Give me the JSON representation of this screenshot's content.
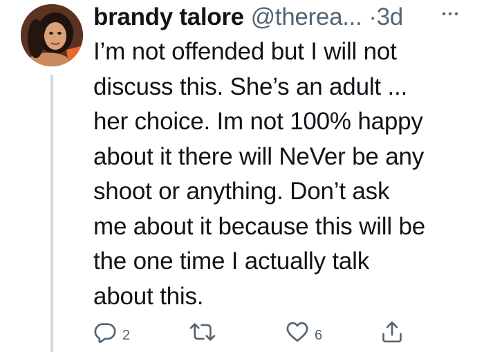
{
  "tweet": {
    "author": {
      "name": "brandy talore",
      "handle": "@therea...",
      "separator": "·",
      "time": "3d",
      "avatar_icon": "avatar-photo"
    },
    "text": "I’m not offended but I will not discuss this. She’s an adult ... her choice. Im not 100% happy about it there will NeVer be any shoot or anything. Don’t ask me about it because this will be the one time I actually talk about this.",
    "lines": [
      "I’m not offended but I will not",
      "discuss this. She’s an adult ...",
      "her choice. Im not 100% happy",
      "about it there will NeVer be any",
      "shoot or anything. Don’t ask",
      "me about it because this will be",
      "the one time I actually talk",
      "about this."
    ],
    "actions": {
      "reply": {
        "icon": "reply-icon",
        "count": "2"
      },
      "retweet": {
        "icon": "retweet-icon",
        "count": ""
      },
      "like": {
        "icon": "heart-icon",
        "count": "6"
      },
      "share": {
        "icon": "share-icon"
      }
    },
    "more_icon": "more-icon"
  },
  "colors": {
    "text": "#0f1419",
    "secondary": "#536471",
    "thread_line": "#cfd9de"
  }
}
